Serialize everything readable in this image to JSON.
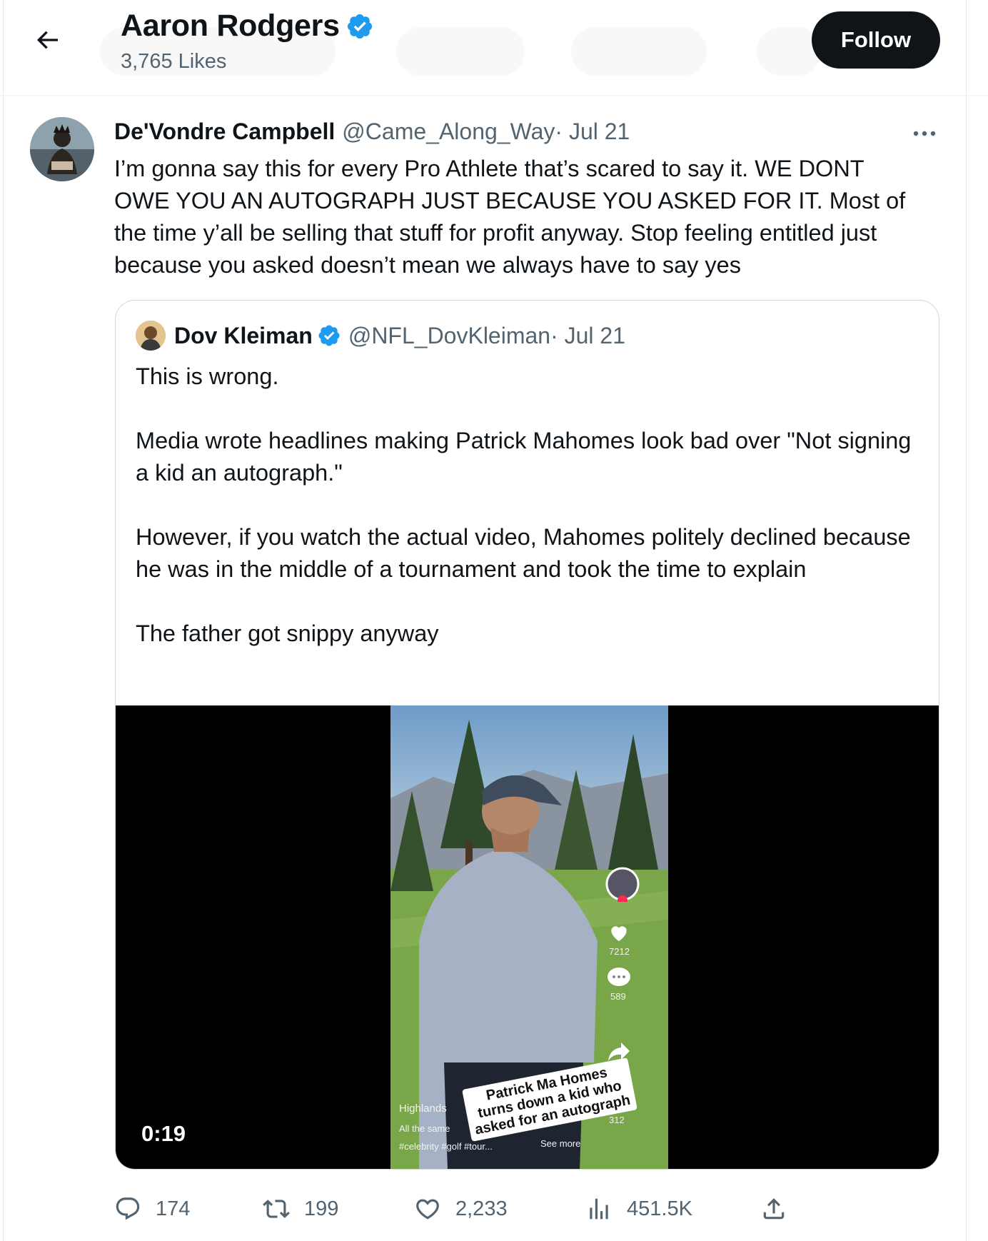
{
  "header": {
    "title": "Aaron Rodgers",
    "subtitle": "3,765 Likes",
    "follow_label": "Follow"
  },
  "tweet": {
    "author_name": "De'Vondre Campbell",
    "author_handle": "@Came_Along_Way",
    "date": " · Jul 21",
    "text": "I’m gonna say this for every Pro Athlete that’s scared to say it. WE DONT OWE YOU AN AUTOGRAPH JUST BECAUSE YOU ASKED FOR IT. Most of the time y’all be selling that stuff for profit anyway. Stop feeling entitled just because you asked doesn’t mean we always have to say yes"
  },
  "quote": {
    "author_name": "Dov Kleiman",
    "author_handle": "@NFL_DovKleiman",
    "date": " · Jul 21",
    "paragraphs": [
      "This is wrong.",
      "Media wrote headlines making Patrick Mahomes look bad over \"Not signing a kid an autograph.\"",
      "However, if you watch the actual video, Mahomes politely declined because he was in the middle of a tournament and took the time to explain",
      "The father got snippy anyway"
    ],
    "video": {
      "duration": "0:19",
      "caption": "Patrick Ma Homes turns down a kid who asked for an autograph",
      "likes": "7212",
      "comments": "589",
      "shares": "312",
      "overlay_left_1": "Highlands",
      "overlay_left_2": "All the same",
      "overlay_hashtags": "#celebrity #golf #tour...",
      "overlay_see_more": "See more"
    }
  },
  "actions": {
    "replies": "174",
    "reposts": "199",
    "likes": "2,233",
    "views": "451.5K"
  },
  "colors": {
    "verified": "#1d9bf0",
    "text_primary": "#0f1419",
    "text_secondary": "#536471",
    "border": "#cfd9de"
  },
  "icons": [
    "back-arrow-icon",
    "verified-badge-icon",
    "more-icon",
    "reply-icon",
    "repost-icon",
    "like-icon",
    "views-icon",
    "share-icon"
  ]
}
